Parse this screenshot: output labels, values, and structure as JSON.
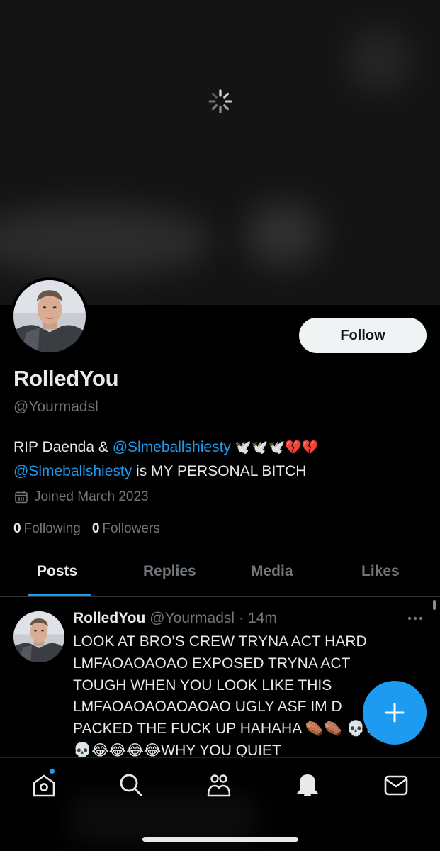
{
  "profile": {
    "display_name": "RolledYou",
    "handle": "@Yourmadsl",
    "follow_label": "Follow",
    "bio_prefix": "RIP Daenda & ",
    "bio_mention_1": "@Slmeballshiesty",
    "bio_emojis": " 🕊️🕊️🕊️💔💔",
    "bio_mention_2": "@Slmeballshiesty",
    "bio_suffix": " is MY PERSONAL BITCH",
    "joined": "Joined March 2023",
    "following_count": "0",
    "following_label": "Following",
    "followers_count": "0",
    "followers_label": "Followers"
  },
  "tabs": [
    {
      "label": "Posts",
      "active": true
    },
    {
      "label": "Replies",
      "active": false
    },
    {
      "label": "Media",
      "active": false
    },
    {
      "label": "Likes",
      "active": false
    }
  ],
  "post": {
    "name": "RolledYou",
    "handle": "@Yourmadsl",
    "separator": "·",
    "time": "14m",
    "text": "LOOK AT BRO’S CREW TRYNA ACT HARD LMFAOAOAOAO EXPOSED TRYNA ACT TOUGH WHEN YOU LOOK LIKE THIS LMFAOAOAOAOAOAO UGLY ASF IM D PACKED THE FUCK UP HAHAHA ⚰️⚰️ 💀💀💀💀😂😂😂😂WHY YOU QUIET"
  },
  "nav": {
    "items": [
      "home-icon",
      "search-icon",
      "communities-icon",
      "notifications-icon",
      "messages-icon"
    ],
    "home_has_notification": true
  },
  "colors": {
    "accent": "#1d9bf0",
    "background": "#000000",
    "text_primary": "#e7e9ea",
    "text_secondary": "#71767b"
  }
}
